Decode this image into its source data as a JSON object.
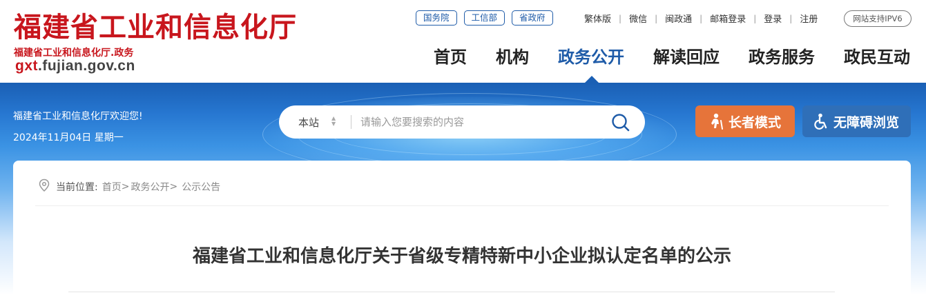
{
  "site": {
    "logo_title": "福建省工业和信息化厅",
    "logo_subtitle": "福建省工业和信息化厅.政务",
    "domain_prefix": "gxt",
    "domain_rest": ".fujian.gov.cn"
  },
  "quick_links": [
    "国务院",
    "工信部",
    "省政府"
  ],
  "top_links": [
    "繁体版",
    "微信",
    "闽政通",
    "邮箱登录",
    "登录",
    "注册"
  ],
  "ipv6_badge": "网站支持IPV6",
  "main_nav": [
    {
      "label": "首页",
      "active": false
    },
    {
      "label": "机构",
      "active": false
    },
    {
      "label": "政务公开",
      "active": true
    },
    {
      "label": "解读回应",
      "active": false
    },
    {
      "label": "政务服务",
      "active": false
    },
    {
      "label": "政民互动",
      "active": false
    }
  ],
  "banner": {
    "welcome": "福建省工业和信息化厅欢迎您!",
    "date": "2024年11月04日 星期一"
  },
  "search": {
    "scope": "本站",
    "placeholder": "请输入您要搜索的内容",
    "value": ""
  },
  "buttons": {
    "elder_mode": "长者模式",
    "accessible": "无障碍浏览"
  },
  "breadcrumb": {
    "label": "当前位置:",
    "items": [
      "首页",
      "政务公开",
      "公示公告"
    ],
    "separator": ">"
  },
  "article": {
    "title": "福建省工业和信息化厅关于省级专精特新中小企业拟认定名单的公示"
  },
  "colors": {
    "brand_red": "#c8161d",
    "brand_blue": "#1e5ba8",
    "elder_orange": "#e6743a",
    "access_blue": "#2f6fb8"
  },
  "icons": {
    "search": "search-icon",
    "scope_arrow": "sort-arrows-icon",
    "elder": "elder-person-icon",
    "accessible": "wheelchair-icon",
    "location": "location-pin-icon"
  }
}
